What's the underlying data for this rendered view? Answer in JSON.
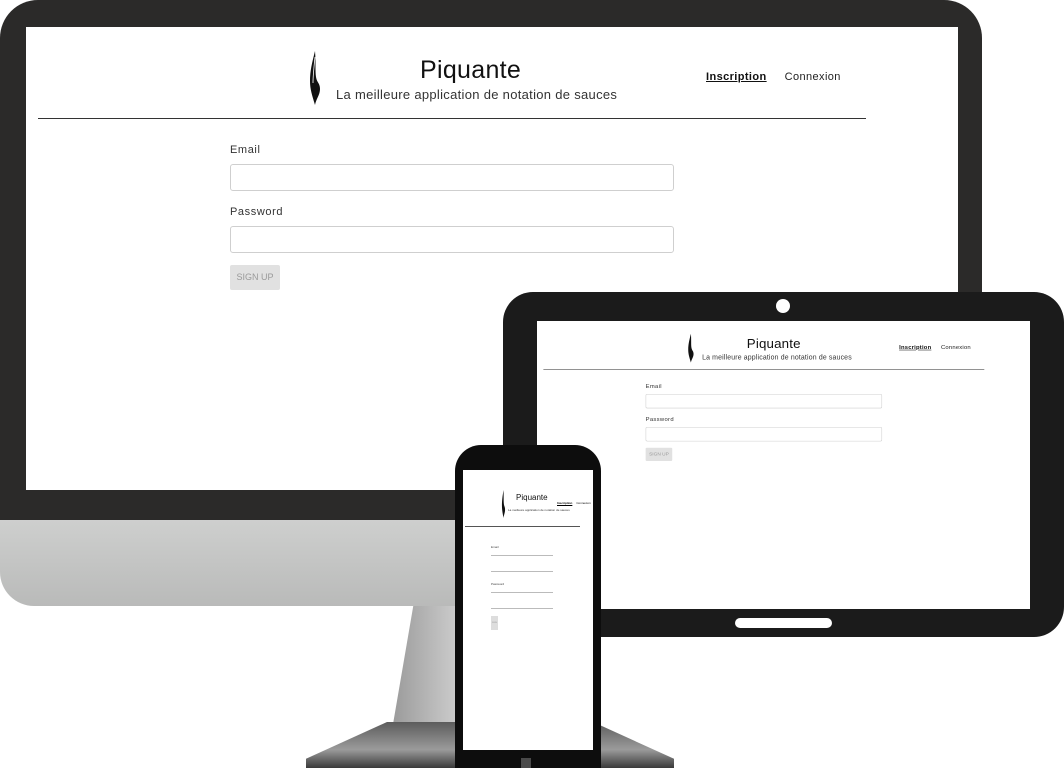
{
  "app": {
    "title": "Piquante",
    "subtitle": "La meilleure application de notation de sauces",
    "nav": {
      "inscription": "Inscription",
      "connexion": "Connexion"
    },
    "form": {
      "email_label": "Email",
      "email_value": "",
      "password_label": "Password",
      "password_value": "",
      "submit_label": "SIGN UP"
    }
  },
  "colors": {
    "monitor_frame": "#2b2a29",
    "tablet_frame": "#1b1b1b",
    "phone_frame": "#0d0d0d",
    "button_bg": "#e1e1e1"
  },
  "icons": {
    "logo": "flame-icon"
  }
}
